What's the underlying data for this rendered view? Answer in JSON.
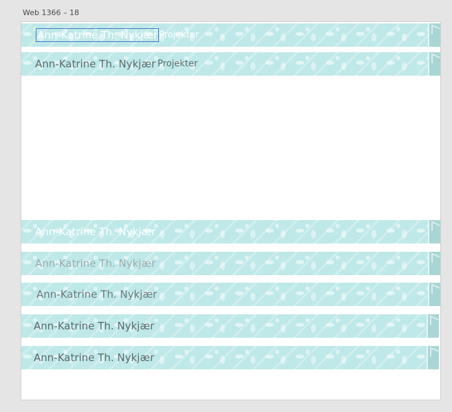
{
  "artboard": {
    "label": "Web 1366 – 18"
  },
  "banners": [
    {
      "name": "Ann-Katrine Th. Nykjær",
      "link": "Projekter"
    },
    {
      "name": "Ann-Katrine Th. Nykjær",
      "link": "Projekter"
    },
    {
      "name": "Ann-Katrine Th. Nykjær"
    },
    {
      "name": "Ann-Katrine Th. Nykjær"
    },
    {
      "name": "Ann-Katrine Th. Nykjær"
    },
    {
      "name": "Ann-Katrine Th. Nykjær"
    },
    {
      "name": "Ann-Katrine Th. Nykjær"
    }
  ],
  "colors": {
    "banner": "#bfe8e8",
    "endcap": "#a9d6d4",
    "selection": "#3a78c8"
  }
}
